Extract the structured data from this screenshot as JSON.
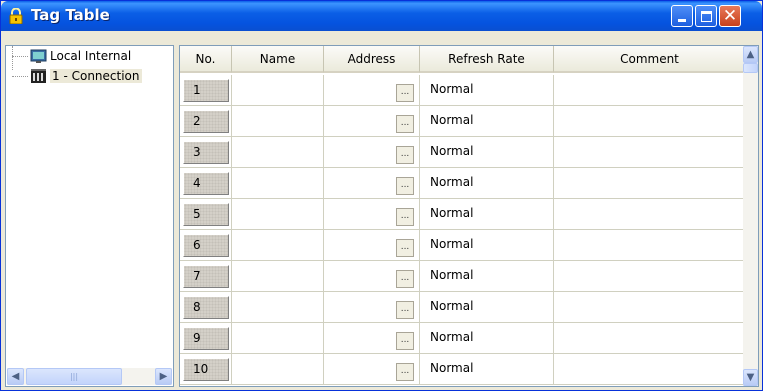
{
  "window": {
    "title": "Tag Table"
  },
  "tree": {
    "items": [
      {
        "label": "Local Internal",
        "icon": "monitor-icon"
      },
      {
        "label": "1 - Connection",
        "icon": "plc-rack-icon"
      }
    ]
  },
  "grid": {
    "columns": [
      "No.",
      "Name",
      "Address",
      "Refresh Rate",
      "Comment"
    ],
    "address_button_label": "...",
    "rows": [
      {
        "no": "1",
        "name": "",
        "address": "",
        "refresh_rate": "Normal",
        "comment": ""
      },
      {
        "no": "2",
        "name": "",
        "address": "",
        "refresh_rate": "Normal",
        "comment": ""
      },
      {
        "no": "3",
        "name": "",
        "address": "",
        "refresh_rate": "Normal",
        "comment": ""
      },
      {
        "no": "4",
        "name": "",
        "address": "",
        "refresh_rate": "Normal",
        "comment": ""
      },
      {
        "no": "5",
        "name": "",
        "address": "",
        "refresh_rate": "Normal",
        "comment": ""
      },
      {
        "no": "6",
        "name": "",
        "address": "",
        "refresh_rate": "Normal",
        "comment": ""
      },
      {
        "no": "7",
        "name": "",
        "address": "",
        "refresh_rate": "Normal",
        "comment": ""
      },
      {
        "no": "8",
        "name": "",
        "address": "",
        "refresh_rate": "Normal",
        "comment": ""
      },
      {
        "no": "9",
        "name": "",
        "address": "",
        "refresh_rate": "Normal",
        "comment": ""
      },
      {
        "no": "10",
        "name": "",
        "address": "",
        "refresh_rate": "Normal",
        "comment": ""
      }
    ]
  },
  "colors": {
    "titlebar": "#0553df",
    "close_button": "#c8411b",
    "window_bg": "#ece9d8"
  }
}
